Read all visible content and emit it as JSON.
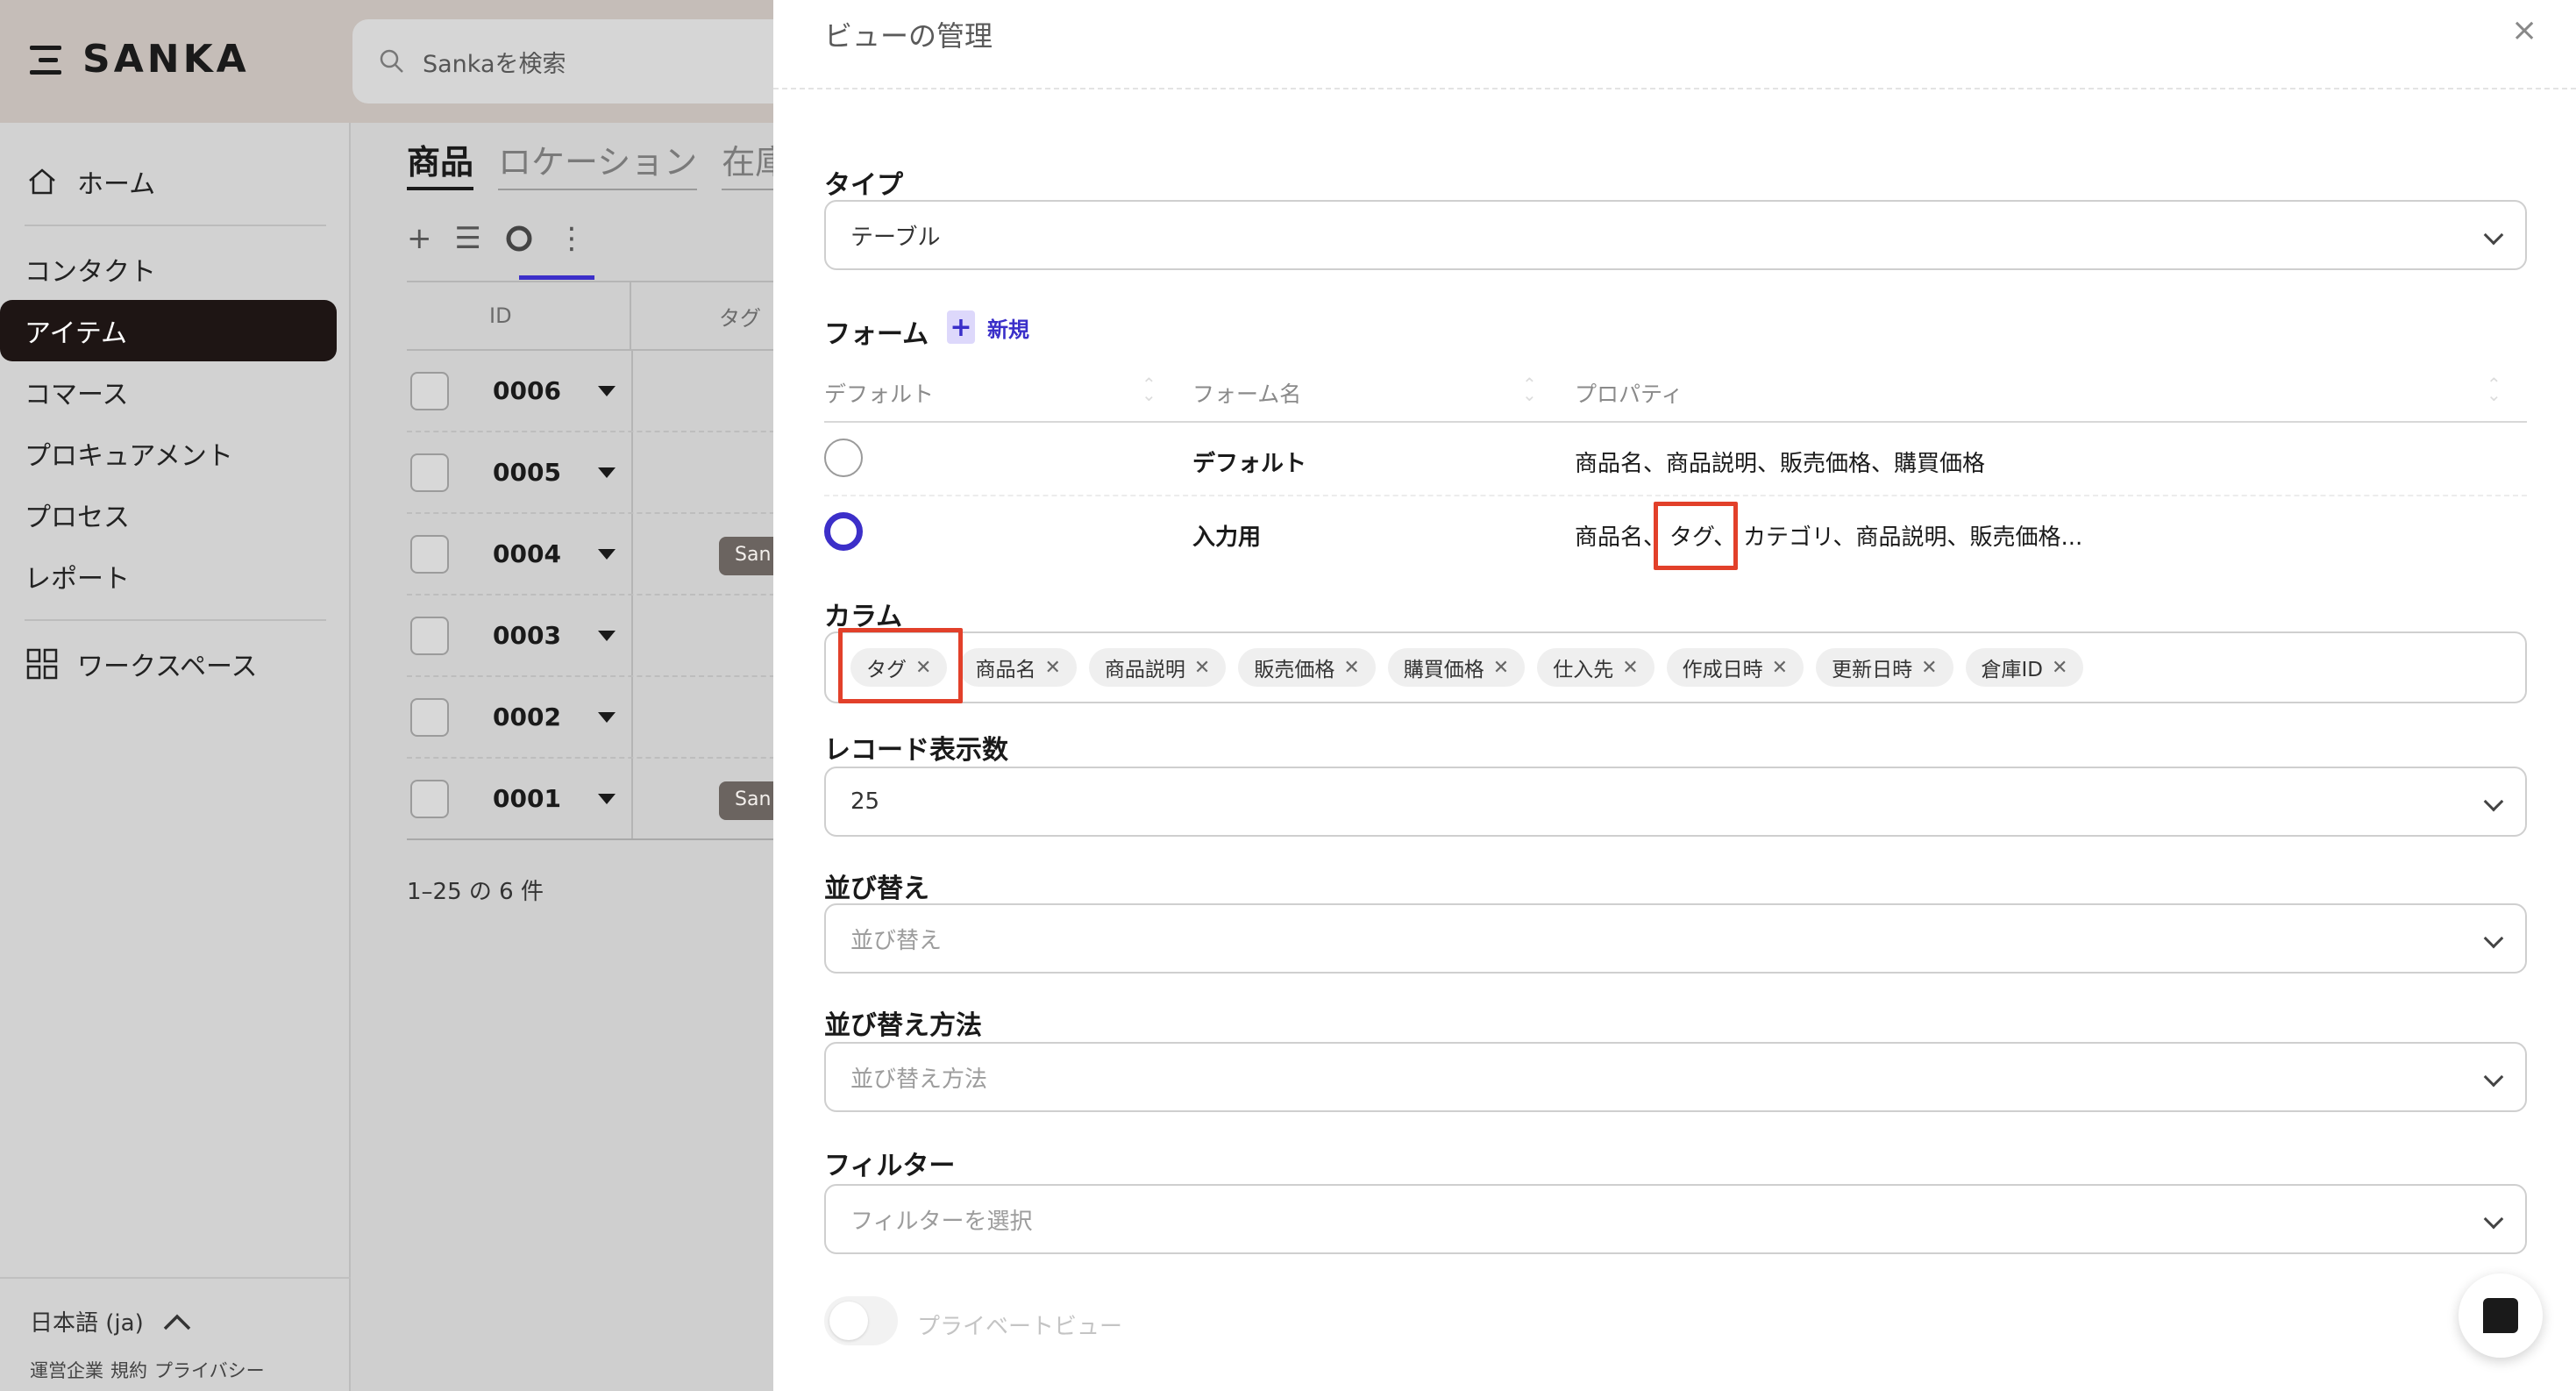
{
  "app": {
    "logo_text": "SANKA"
  },
  "search": {
    "placeholder": "Sankaを検索"
  },
  "sidebar": {
    "items": [
      {
        "label": "ホーム",
        "icon": "home-icon"
      },
      {
        "label": "コンタクト"
      },
      {
        "label": "アイテム",
        "active": true
      },
      {
        "label": "コマース"
      },
      {
        "label": "プロキュアメント"
      },
      {
        "label": "プロセス"
      },
      {
        "label": "レポート"
      },
      {
        "label": "ワークスペース",
        "icon": "workspace-icon"
      }
    ],
    "language": "日本語 (ja)",
    "footer_links": [
      "運営企業",
      "規約",
      "プライバシー"
    ]
  },
  "main": {
    "tabs": [
      "商品",
      "ロケーション",
      "在庫"
    ],
    "toolbar": {
      "add": "+",
      "list": "☰",
      "more": "⋮"
    },
    "table": {
      "headers": [
        "ID",
        "タグ"
      ],
      "rows": [
        {
          "id": "0006",
          "tag": ""
        },
        {
          "id": "0005",
          "tag": ""
        },
        {
          "id": "0004",
          "tag": "San"
        },
        {
          "id": "0003",
          "tag": ""
        },
        {
          "id": "0002",
          "tag": ""
        },
        {
          "id": "0001",
          "tag": "San"
        }
      ]
    },
    "count_text": "1–25 の 6 件"
  },
  "panel": {
    "title": "ビューの管理",
    "close": "×",
    "type": {
      "label": "タイプ",
      "value": "テーブル"
    },
    "form": {
      "label": "フォーム",
      "new_label": "新規",
      "headers": [
        "デフォルト",
        "フォーム名",
        "プロパティ"
      ],
      "rows": [
        {
          "name": "デフォルト",
          "properties": "商品名、商品説明、販売価格、購買価格",
          "selected": false
        },
        {
          "name": "入力用",
          "properties_parts": [
            "商品名、",
            "タグ、",
            "カテゴリ、商品説明、販売価格..."
          ],
          "selected": true
        }
      ]
    },
    "columns": {
      "label": "カラム",
      "chips": [
        "タグ",
        "商品名",
        "商品説明",
        "販売価格",
        "購買価格",
        "仕入先",
        "作成日時",
        "更新日時",
        "倉庫ID"
      ]
    },
    "records": {
      "label": "レコード表示数",
      "value": "25"
    },
    "sort": {
      "label": "並び替え",
      "placeholder": "並び替え"
    },
    "sort_method": {
      "label": "並び替え方法",
      "placeholder": "並び替え方法"
    },
    "filter": {
      "label": "フィルター",
      "placeholder": "フィルターを選択"
    },
    "private_view": {
      "label": "プライベートビュー",
      "on": false
    }
  },
  "colors": {
    "accent": "#3c2fc9",
    "highlight": "#e2402a",
    "active_nav": "#1e1514"
  }
}
